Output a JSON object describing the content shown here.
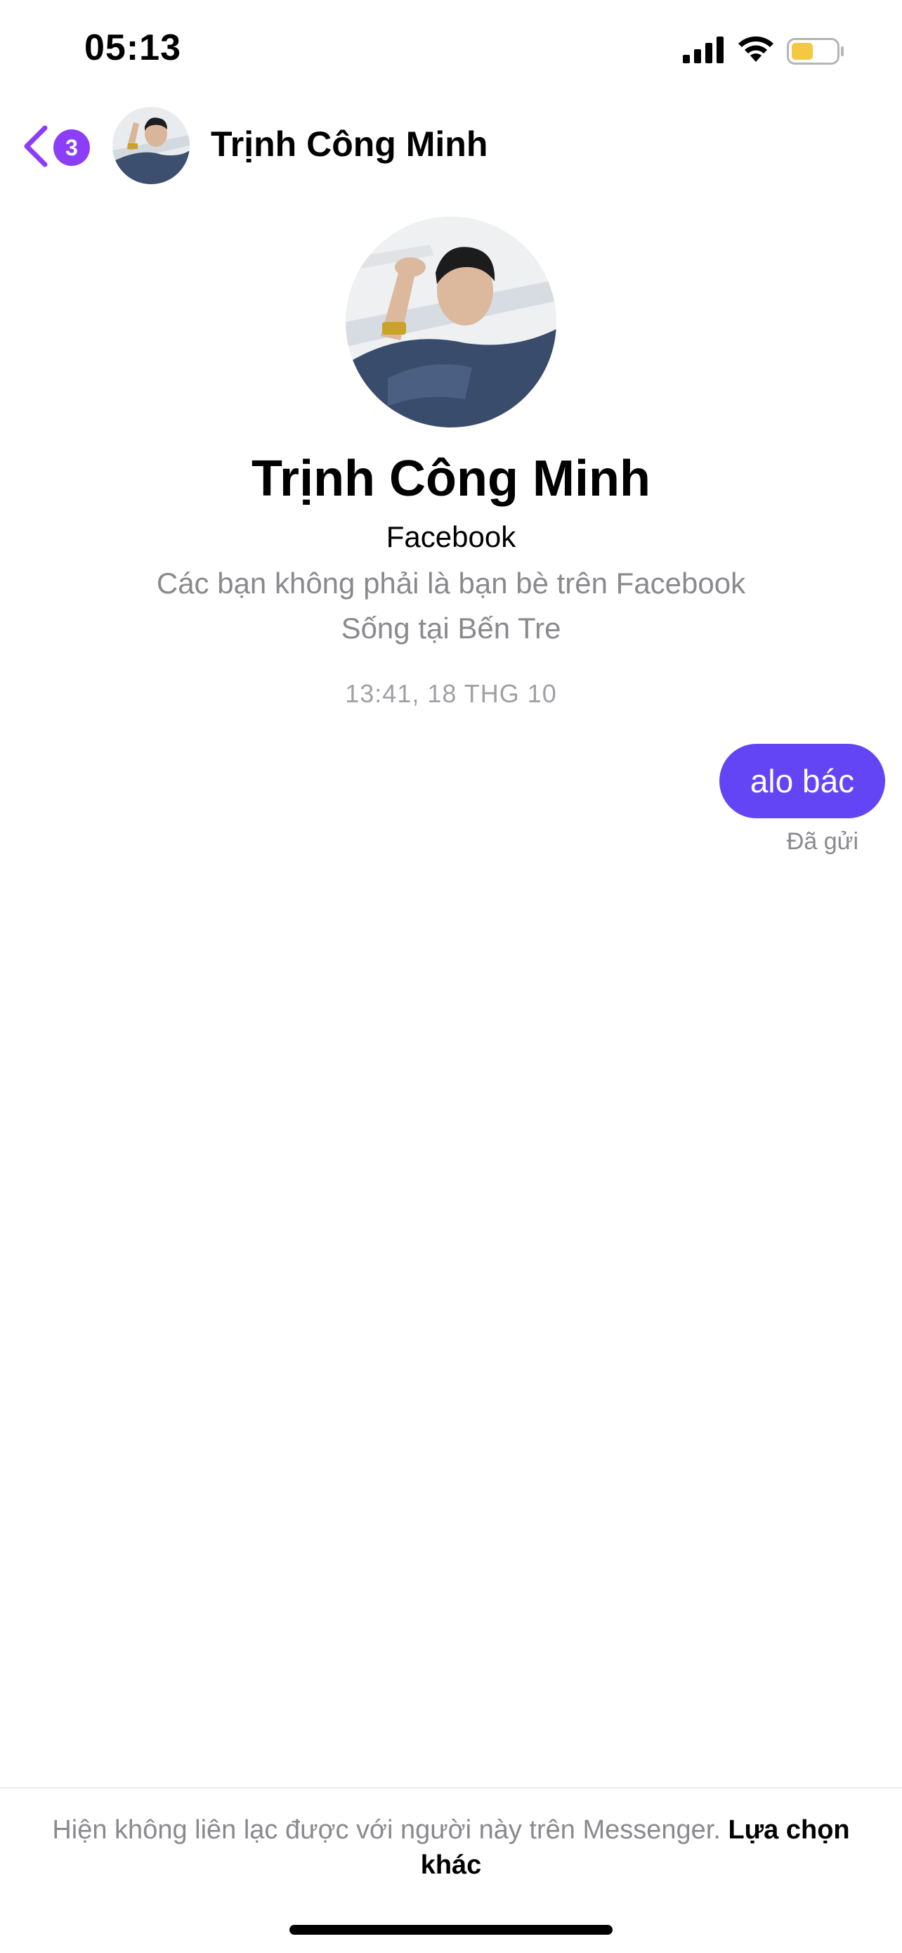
{
  "status_bar": {
    "time": "05:13",
    "icons": [
      "cellular-signal-icon",
      "wifi-icon",
      "battery-icon"
    ],
    "battery_color": "#f5c842"
  },
  "header": {
    "back_icon": "chevron-left-icon",
    "unread_count": "3",
    "contact_name": "Trịnh Công Minh",
    "accent_color": "#8b3df7"
  },
  "profile": {
    "name": "Trịnh Công Minh",
    "platform": "Facebook",
    "friend_status": "Các bạn không phải là bạn bè trên Facebook",
    "location": "Sống tại Bến Tre"
  },
  "conversation": {
    "timestamp": "13:41, 18 THG 10",
    "messages": [
      {
        "text": "alo bác",
        "from": "me",
        "status": "Đã gửi"
      }
    ],
    "bubble_color": "#6445f5"
  },
  "footer": {
    "notice": "Hiện không liên lạc được với người này trên Messenger.",
    "action_label": "Lựa chọn khác"
  }
}
